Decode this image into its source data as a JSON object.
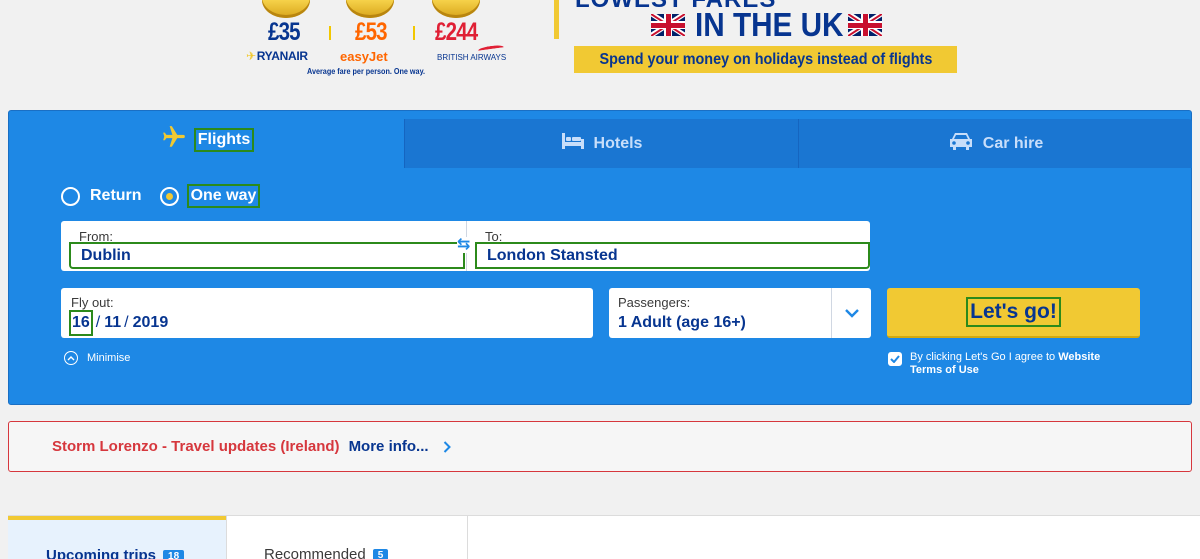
{
  "banner": {
    "ryanair_price": "£35",
    "easyjet_price": "£53",
    "ba_price": "£244",
    "ryanair_brand": "RYANAIR",
    "easyjet_brand": "easyJet",
    "ba_brand": "BRITISH AIRWAYS",
    "average_note": "Average fare per person. One way.",
    "headline_top": "LOWEST FARES",
    "headline": "IN THE UK",
    "tagline": "Spend your money on holidays instead of flights"
  },
  "tabs": {
    "flights": "Flights",
    "hotels": "Hotels",
    "car_hire": "Car hire"
  },
  "trip_type": {
    "return_label": "Return",
    "one_way_label": "One way",
    "selected": "One way"
  },
  "route": {
    "from_label": "From:",
    "from_value": "Dublin",
    "to_label": "To:",
    "to_value": "London Stansted"
  },
  "flyout": {
    "label": "Fly out:",
    "day": "16",
    "month": "11",
    "year": "2019"
  },
  "passengers": {
    "label": "Passengers:",
    "value": "1 Adult (age 16+)"
  },
  "go_button": "Let's go!",
  "minimise_label": "Minimise",
  "terms": {
    "prefix": "By clicking Let's Go I agree to ",
    "link": "Website Terms of Use",
    "checked": true
  },
  "alert": {
    "text": "Storm Lorenzo - Travel updates (Ireland)",
    "link": "More info..."
  },
  "trips_tabs": [
    {
      "label": "Upcoming trips",
      "count": "18"
    },
    {
      "label": "Recommended",
      "count": "5"
    }
  ],
  "colors": {
    "brand_blue": "#073590",
    "widget_blue": "#1e88e5",
    "yellow": "#f1c933",
    "alert_red": "#d6373d",
    "focus_green": "#2c8a1b"
  }
}
